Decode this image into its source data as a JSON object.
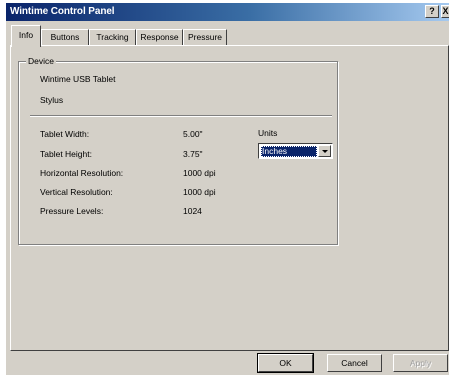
{
  "window": {
    "title": "Wintime Control Panel",
    "help_label": "?",
    "close_label": "X"
  },
  "tabs": [
    {
      "label": "Info",
      "active": true
    },
    {
      "label": "Buttons",
      "active": false
    },
    {
      "label": "Tracking",
      "active": false
    },
    {
      "label": "Response",
      "active": false
    },
    {
      "label": "Pressure",
      "active": false
    }
  ],
  "device": {
    "group_title": "Device",
    "tablet_name": "Wintime USB Tablet",
    "pointer": "Stylus"
  },
  "info": {
    "width_label": "Tablet Width:",
    "width_value": "5.00\"",
    "height_label": "Tablet Height:",
    "height_value": "3.75\"",
    "hres_label": "Horizontal Resolution:",
    "hres_value": "1000 dpi",
    "vres_label": "Vertical Resolution:",
    "vres_value": "1000 dpi",
    "pressure_label": "Pressure Levels:",
    "pressure_value": "1024"
  },
  "units": {
    "label": "Units",
    "selected": "Inches"
  },
  "buttons": {
    "ok": "OK",
    "cancel": "Cancel",
    "apply": "Apply"
  }
}
